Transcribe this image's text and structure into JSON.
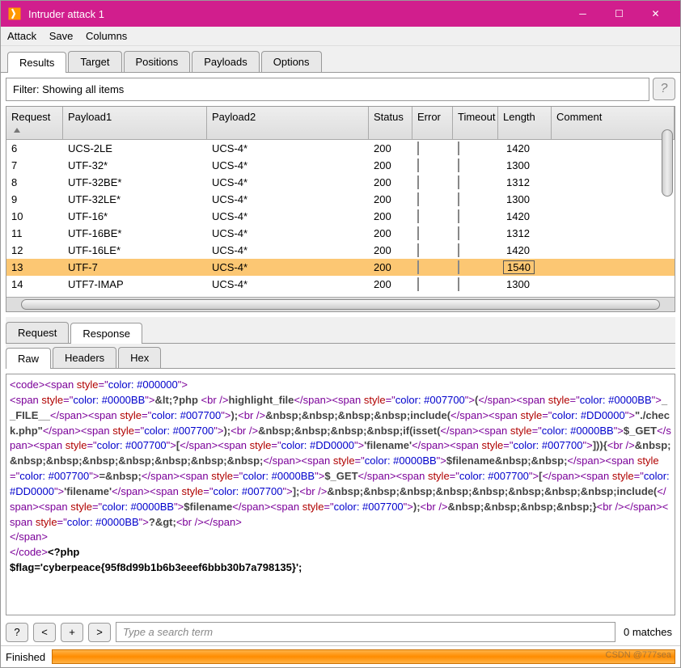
{
  "window": {
    "title": "Intruder attack 1"
  },
  "menu": {
    "items": [
      "Attack",
      "Save",
      "Columns"
    ]
  },
  "main_tabs": [
    "Results",
    "Target",
    "Positions",
    "Payloads",
    "Options"
  ],
  "main_tabs_active": 0,
  "filter": {
    "text": "Filter: Showing all items"
  },
  "table": {
    "headers": {
      "request": "Request",
      "payload1": "Payload1",
      "payload2": "Payload2",
      "status": "Status",
      "error": "Error",
      "timeout": "Timeout",
      "length": "Length",
      "comment": "Comment"
    },
    "rows": [
      {
        "request": "6",
        "payload1": "UCS-2LE",
        "payload2": "UCS-4*",
        "status": "200",
        "length": "1420"
      },
      {
        "request": "7",
        "payload1": "UTF-32*",
        "payload2": "UCS-4*",
        "status": "200",
        "length": "1300"
      },
      {
        "request": "8",
        "payload1": "UTF-32BE*",
        "payload2": "UCS-4*",
        "status": "200",
        "length": "1312"
      },
      {
        "request": "9",
        "payload1": "UTF-32LE*",
        "payload2": "UCS-4*",
        "status": "200",
        "length": "1300"
      },
      {
        "request": "10",
        "payload1": "UTF-16*",
        "payload2": "UCS-4*",
        "status": "200",
        "length": "1420"
      },
      {
        "request": "11",
        "payload1": "UTF-16BE*",
        "payload2": "UCS-4*",
        "status": "200",
        "length": "1312"
      },
      {
        "request": "12",
        "payload1": "UTF-16LE*",
        "payload2": "UCS-4*",
        "status": "200",
        "length": "1420"
      },
      {
        "request": "13",
        "payload1": "UTF-7",
        "payload2": "UCS-4*",
        "status": "200",
        "length": "1540",
        "selected": true
      },
      {
        "request": "14",
        "payload1": "UTF7-IMAP",
        "payload2": "UCS-4*",
        "status": "200",
        "length": "1300"
      }
    ]
  },
  "detail_tabs": [
    "Request",
    "Response"
  ],
  "detail_tabs_active": 1,
  "view_tabs": [
    "Raw",
    "Headers",
    "Hex"
  ],
  "view_tabs_active": 0,
  "response_lines": [
    {
      "parts": [
        {
          "t": "<",
          "c": "tag"
        },
        {
          "t": "code",
          "c": "tag"
        },
        {
          "t": "><",
          "c": "tag"
        },
        {
          "t": "span ",
          "c": "tag"
        },
        {
          "t": "style",
          "c": "attr"
        },
        {
          "t": "=\"",
          "c": "tag"
        },
        {
          "t": "color: #000000",
          "c": "str"
        },
        {
          "t": "\">",
          "c": "tag"
        }
      ]
    },
    {
      "parts": [
        {
          "t": "<",
          "c": "tag"
        },
        {
          "t": "span ",
          "c": "tag"
        },
        {
          "t": "style",
          "c": "attr"
        },
        {
          "t": "=\"",
          "c": "tag"
        },
        {
          "t": "color: #0000BB",
          "c": "str"
        },
        {
          "t": "\">",
          "c": "tag"
        },
        {
          "t": "&lt;?php ",
          "c": "blk"
        },
        {
          "t": "<",
          "c": "tag"
        },
        {
          "t": "br ",
          "c": "tag"
        },
        {
          "t": "/>",
          "c": "tag"
        },
        {
          "t": "highlight_file",
          "c": "blk"
        },
        {
          "t": "</",
          "c": "tag"
        },
        {
          "t": "span",
          "c": "tag"
        },
        {
          "t": "><",
          "c": "tag"
        },
        {
          "t": "span ",
          "c": "tag"
        },
        {
          "t": "style",
          "c": "attr"
        },
        {
          "t": "=\"",
          "c": "tag"
        },
        {
          "t": "color: #007700",
          "c": "str"
        },
        {
          "t": "\">",
          "c": "tag"
        },
        {
          "t": "(",
          "c": "blk"
        },
        {
          "t": "</",
          "c": "tag"
        },
        {
          "t": "span",
          "c": "tag"
        },
        {
          "t": "><",
          "c": "tag"
        },
        {
          "t": "span ",
          "c": "tag"
        },
        {
          "t": "style",
          "c": "attr"
        },
        {
          "t": "=\"",
          "c": "tag"
        },
        {
          "t": "color: #0000BB",
          "c": "str"
        },
        {
          "t": "\">",
          "c": "tag"
        },
        {
          "t": "__FILE__",
          "c": "blk"
        },
        {
          "t": "</",
          "c": "tag"
        },
        {
          "t": "span",
          "c": "tag"
        },
        {
          "t": "><",
          "c": "tag"
        },
        {
          "t": "span ",
          "c": "tag"
        },
        {
          "t": "style",
          "c": "attr"
        },
        {
          "t": "=\"",
          "c": "tag"
        },
        {
          "t": "color: #007700",
          "c": "str"
        },
        {
          "t": "\">",
          "c": "tag"
        },
        {
          "t": ");",
          "c": "blk"
        },
        {
          "t": "<",
          "c": "tag"
        },
        {
          "t": "br ",
          "c": "tag"
        },
        {
          "t": "/>",
          "c": "tag"
        },
        {
          "t": "&nbsp;&nbsp;&nbsp;&nbsp;include(",
          "c": "blk"
        },
        {
          "t": "</",
          "c": "tag"
        },
        {
          "t": "span",
          "c": "tag"
        },
        {
          "t": "><",
          "c": "tag"
        },
        {
          "t": "span ",
          "c": "tag"
        },
        {
          "t": "style",
          "c": "attr"
        },
        {
          "t": "=\"",
          "c": "tag"
        },
        {
          "t": "color: #DD0000",
          "c": "str"
        },
        {
          "t": "\">",
          "c": "tag"
        },
        {
          "t": "\"./check.php\"",
          "c": "blk"
        },
        {
          "t": "</",
          "c": "tag"
        },
        {
          "t": "span",
          "c": "tag"
        },
        {
          "t": "><",
          "c": "tag"
        },
        {
          "t": "span ",
          "c": "tag"
        },
        {
          "t": "style",
          "c": "attr"
        },
        {
          "t": "=\"",
          "c": "tag"
        },
        {
          "t": "color: #007700",
          "c": "str"
        },
        {
          "t": "\">",
          "c": "tag"
        },
        {
          "t": ");",
          "c": "blk"
        },
        {
          "t": "<",
          "c": "tag"
        },
        {
          "t": "br ",
          "c": "tag"
        },
        {
          "t": "/>",
          "c": "tag"
        },
        {
          "t": "&nbsp;&nbsp;&nbsp;&nbsp;if(isset(",
          "c": "blk"
        },
        {
          "t": "</",
          "c": "tag"
        },
        {
          "t": "span",
          "c": "tag"
        },
        {
          "t": "><",
          "c": "tag"
        },
        {
          "t": "span ",
          "c": "tag"
        },
        {
          "t": "style",
          "c": "attr"
        },
        {
          "t": "=\"",
          "c": "tag"
        },
        {
          "t": "color: #0000BB",
          "c": "str"
        },
        {
          "t": "\">",
          "c": "tag"
        },
        {
          "t": "$_GET",
          "c": "blk"
        },
        {
          "t": "</",
          "c": "tag"
        },
        {
          "t": "span",
          "c": "tag"
        },
        {
          "t": "><",
          "c": "tag"
        },
        {
          "t": "span ",
          "c": "tag"
        },
        {
          "t": "style",
          "c": "attr"
        },
        {
          "t": "=\"",
          "c": "tag"
        },
        {
          "t": "color: #007700",
          "c": "str"
        },
        {
          "t": "\">",
          "c": "tag"
        },
        {
          "t": "[",
          "c": "blk"
        },
        {
          "t": "</",
          "c": "tag"
        },
        {
          "t": "span",
          "c": "tag"
        },
        {
          "t": "><",
          "c": "tag"
        },
        {
          "t": "span ",
          "c": "tag"
        },
        {
          "t": "style",
          "c": "attr"
        },
        {
          "t": "=\"",
          "c": "tag"
        },
        {
          "t": "color: #DD0000",
          "c": "str"
        },
        {
          "t": "\">",
          "c": "tag"
        },
        {
          "t": "'filename'",
          "c": "blk"
        },
        {
          "t": "</",
          "c": "tag"
        },
        {
          "t": "span",
          "c": "tag"
        },
        {
          "t": "><",
          "c": "tag"
        },
        {
          "t": "span ",
          "c": "tag"
        },
        {
          "t": "style",
          "c": "attr"
        },
        {
          "t": "=\"",
          "c": "tag"
        },
        {
          "t": "color: #007700",
          "c": "str"
        },
        {
          "t": "\">",
          "c": "tag"
        },
        {
          "t": "])){",
          "c": "blk"
        },
        {
          "t": "<",
          "c": "tag"
        },
        {
          "t": "br ",
          "c": "tag"
        },
        {
          "t": "/>",
          "c": "tag"
        },
        {
          "t": "&nbsp;&nbsp;&nbsp;&nbsp;&nbsp;&nbsp;&nbsp;&nbsp;",
          "c": "blk"
        },
        {
          "t": "</",
          "c": "tag"
        },
        {
          "t": "span",
          "c": "tag"
        },
        {
          "t": "><",
          "c": "tag"
        },
        {
          "t": "span ",
          "c": "tag"
        },
        {
          "t": "style",
          "c": "attr"
        },
        {
          "t": "=\"",
          "c": "tag"
        },
        {
          "t": "color: #0000BB",
          "c": "str"
        },
        {
          "t": "\">",
          "c": "tag"
        },
        {
          "t": "$filename&nbsp;&nbsp;",
          "c": "blk"
        },
        {
          "t": "</",
          "c": "tag"
        },
        {
          "t": "span",
          "c": "tag"
        },
        {
          "t": "><",
          "c": "tag"
        },
        {
          "t": "span ",
          "c": "tag"
        },
        {
          "t": "style",
          "c": "attr"
        },
        {
          "t": "=\"",
          "c": "tag"
        },
        {
          "t": "color: #007700",
          "c": "str"
        },
        {
          "t": "\">",
          "c": "tag"
        },
        {
          "t": "=&nbsp;",
          "c": "blk"
        },
        {
          "t": "</",
          "c": "tag"
        },
        {
          "t": "span",
          "c": "tag"
        },
        {
          "t": "><",
          "c": "tag"
        },
        {
          "t": "span ",
          "c": "tag"
        },
        {
          "t": "style",
          "c": "attr"
        },
        {
          "t": "=\"",
          "c": "tag"
        },
        {
          "t": "color: #0000BB",
          "c": "str"
        },
        {
          "t": "\">",
          "c": "tag"
        },
        {
          "t": "$_GET",
          "c": "blk"
        },
        {
          "t": "</",
          "c": "tag"
        },
        {
          "t": "span",
          "c": "tag"
        },
        {
          "t": "><",
          "c": "tag"
        },
        {
          "t": "span ",
          "c": "tag"
        },
        {
          "t": "style",
          "c": "attr"
        },
        {
          "t": "=\"",
          "c": "tag"
        },
        {
          "t": "color: #007700",
          "c": "str"
        },
        {
          "t": "\">",
          "c": "tag"
        },
        {
          "t": "[",
          "c": "blk"
        },
        {
          "t": "</",
          "c": "tag"
        },
        {
          "t": "span",
          "c": "tag"
        },
        {
          "t": "><",
          "c": "tag"
        },
        {
          "t": "span ",
          "c": "tag"
        },
        {
          "t": "style",
          "c": "attr"
        },
        {
          "t": "=\"",
          "c": "tag"
        },
        {
          "t": "color: #DD0000",
          "c": "str"
        },
        {
          "t": "\">",
          "c": "tag"
        },
        {
          "t": "'filename'",
          "c": "blk"
        },
        {
          "t": "</",
          "c": "tag"
        },
        {
          "t": "span",
          "c": "tag"
        },
        {
          "t": "><",
          "c": "tag"
        },
        {
          "t": "span ",
          "c": "tag"
        },
        {
          "t": "style",
          "c": "attr"
        },
        {
          "t": "=\"",
          "c": "tag"
        },
        {
          "t": "color: #007700",
          "c": "str"
        },
        {
          "t": "\">",
          "c": "tag"
        },
        {
          "t": "];",
          "c": "blk"
        },
        {
          "t": "<",
          "c": "tag"
        },
        {
          "t": "br ",
          "c": "tag"
        },
        {
          "t": "/>",
          "c": "tag"
        },
        {
          "t": "&nbsp;&nbsp;&nbsp;&nbsp;&nbsp;&nbsp;&nbsp;&nbsp;include(",
          "c": "blk"
        },
        {
          "t": "</",
          "c": "tag"
        },
        {
          "t": "span",
          "c": "tag"
        },
        {
          "t": "><",
          "c": "tag"
        },
        {
          "t": "span ",
          "c": "tag"
        },
        {
          "t": "style",
          "c": "attr"
        },
        {
          "t": "=\"",
          "c": "tag"
        },
        {
          "t": "color: #0000BB",
          "c": "str"
        },
        {
          "t": "\">",
          "c": "tag"
        },
        {
          "t": "$filename",
          "c": "blk"
        },
        {
          "t": "</",
          "c": "tag"
        },
        {
          "t": "span",
          "c": "tag"
        },
        {
          "t": "><",
          "c": "tag"
        },
        {
          "t": "span ",
          "c": "tag"
        },
        {
          "t": "style",
          "c": "attr"
        },
        {
          "t": "=\"",
          "c": "tag"
        },
        {
          "t": "color: #007700",
          "c": "str"
        },
        {
          "t": "\">",
          "c": "tag"
        },
        {
          "t": ");",
          "c": "blk"
        },
        {
          "t": "<",
          "c": "tag"
        },
        {
          "t": "br ",
          "c": "tag"
        },
        {
          "t": "/>",
          "c": "tag"
        },
        {
          "t": "&nbsp;&nbsp;&nbsp;&nbsp;}",
          "c": "blk"
        },
        {
          "t": "<",
          "c": "tag"
        },
        {
          "t": "br ",
          "c": "tag"
        },
        {
          "t": "/>",
          "c": "tag"
        },
        {
          "t": "</",
          "c": "tag"
        },
        {
          "t": "span",
          "c": "tag"
        },
        {
          "t": "><",
          "c": "tag"
        },
        {
          "t": "span ",
          "c": "tag"
        },
        {
          "t": "style",
          "c": "attr"
        },
        {
          "t": "=\"",
          "c": "tag"
        },
        {
          "t": "color: #0000BB",
          "c": "str"
        },
        {
          "t": "\">",
          "c": "tag"
        },
        {
          "t": "?&gt;",
          "c": "blk"
        },
        {
          "t": "<",
          "c": "tag"
        },
        {
          "t": "br ",
          "c": "tag"
        },
        {
          "t": "/></",
          "c": "tag"
        },
        {
          "t": "span",
          "c": "tag"
        },
        {
          "t": ">",
          "c": "tag"
        }
      ]
    },
    {
      "parts": [
        {
          "t": "</",
          "c": "tag"
        },
        {
          "t": "span",
          "c": "tag"
        },
        {
          "t": ">",
          "c": "tag"
        }
      ]
    },
    {
      "parts": [
        {
          "t": "</",
          "c": "tag"
        },
        {
          "t": "code",
          "c": "tag"
        },
        {
          "t": ">",
          "c": "tag"
        },
        {
          "t": "<?php",
          "c": "bold"
        }
      ]
    },
    {
      "parts": [
        {
          "t": "$flag='cyberpeace{95f8d99b1b6b3eeef6bbb30b7a798135}';",
          "c": "bold"
        }
      ]
    }
  ],
  "search": {
    "placeholder": "Type a search term",
    "matches": "0 matches",
    "buttons": [
      "?",
      "<",
      "+",
      ">"
    ]
  },
  "status": {
    "label": "Finished",
    "watermark": "CSDN @777sea"
  }
}
